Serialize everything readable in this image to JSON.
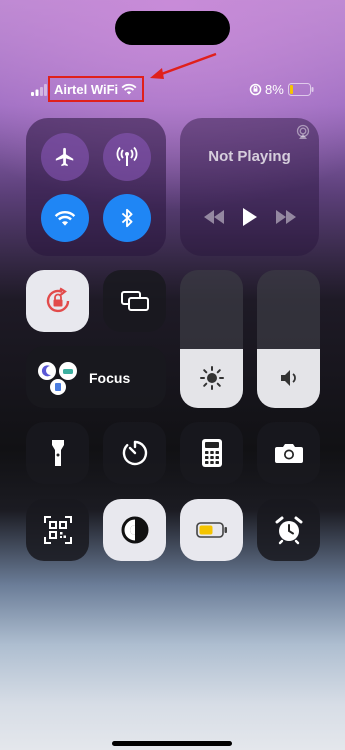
{
  "status_bar": {
    "carrier": "Airtel WiFi",
    "battery_percent": "8%"
  },
  "media": {
    "title": "Not Playing"
  },
  "focus": {
    "label": "Focus"
  },
  "sliders": {
    "brightness_level": 0.43,
    "volume_level": 0.43
  },
  "colors": {
    "annotation_red": "#e0201b",
    "toggle_blue": "#1f86f5",
    "battery_low_yellow": "#f5c400"
  },
  "icons": {
    "connectivity": [
      "airplane-icon",
      "cellular-antenna-icon",
      "wifi-icon",
      "bluetooth-icon"
    ],
    "media": [
      "airplay-icon",
      "rewind-icon",
      "play-icon",
      "fast-forward-icon"
    ],
    "row3": [
      "flashlight-icon",
      "timer-icon",
      "calculator-icon",
      "camera-icon"
    ],
    "row4": [
      "qr-scanner-icon",
      "dark-mode-icon",
      "low-power-battery-icon",
      "alarm-clock-icon"
    ]
  }
}
